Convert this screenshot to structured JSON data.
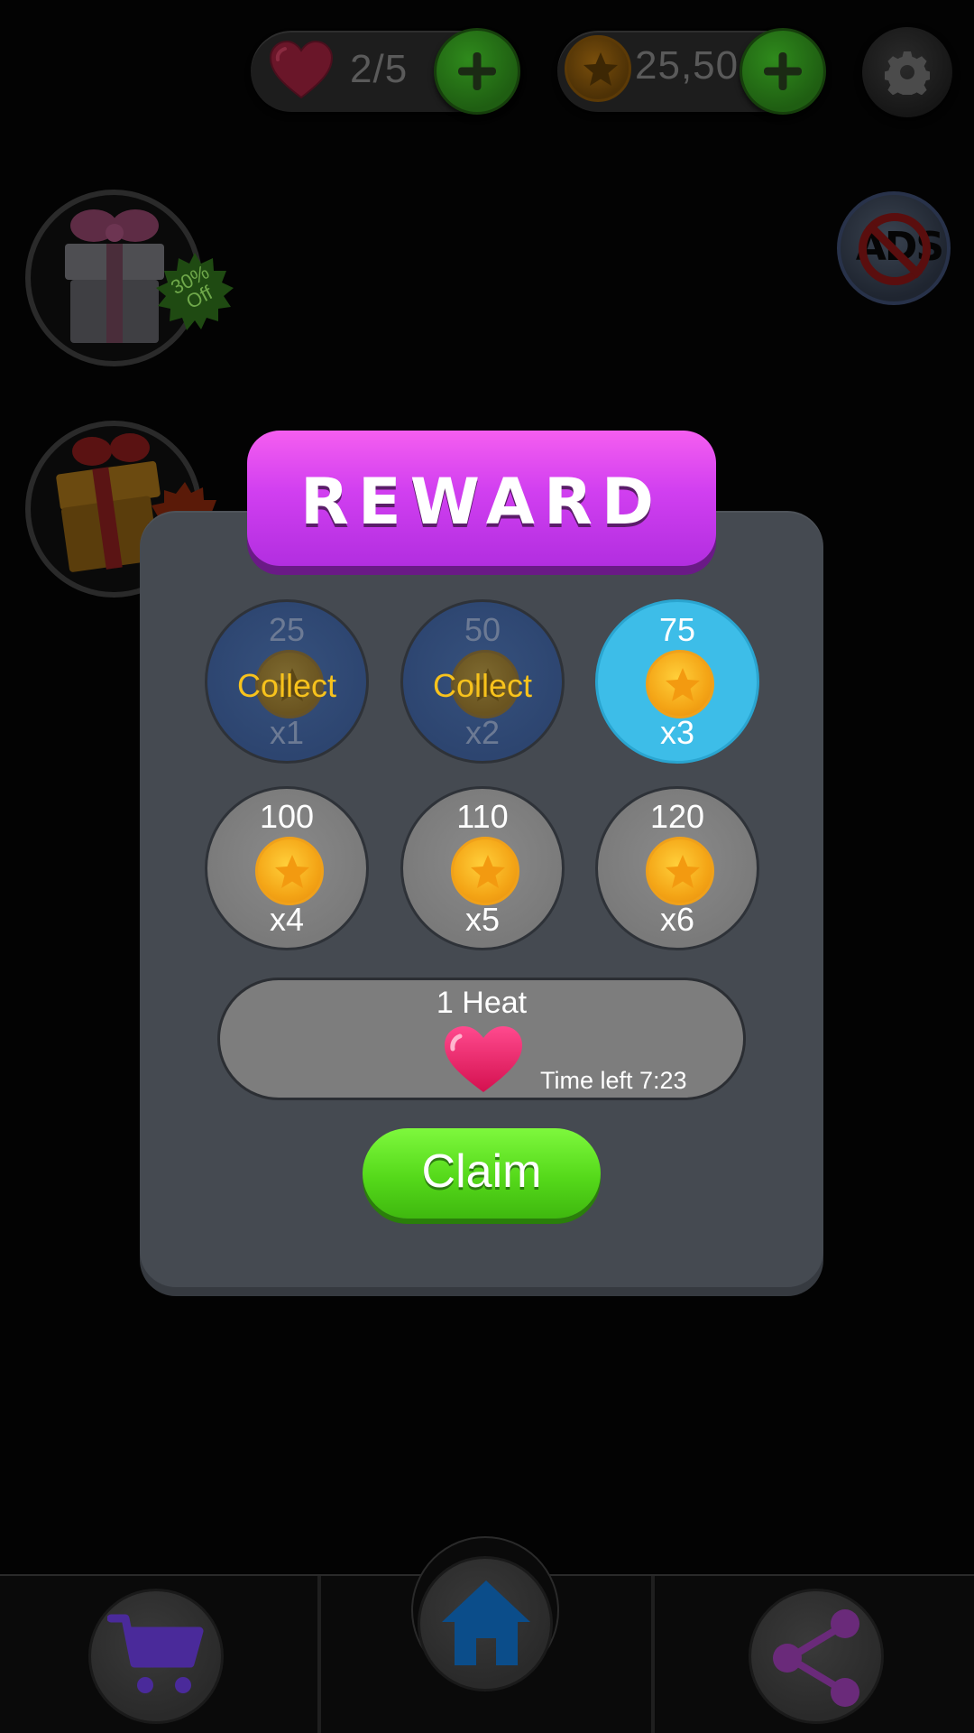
{
  "hud": {
    "lives": "2/5",
    "coins": "25,50",
    "icons": [
      "heart-icon",
      "add-lives-plus-icon",
      "coin-icon",
      "add-coins-plus-icon",
      "gear-icon"
    ]
  },
  "side": {
    "offer_badge": "30% Off",
    "ads_label": "ADS"
  },
  "dialog": {
    "title": "REWARD",
    "tiles": [
      {
        "value": "25",
        "multiplier": "x1",
        "state": "collected",
        "overlay": "Collect"
      },
      {
        "value": "50",
        "multiplier": "x2",
        "state": "collected",
        "overlay": "Collect"
      },
      {
        "value": "75",
        "multiplier": "x3",
        "state": "active"
      },
      {
        "value": "100",
        "multiplier": "x4",
        "state": "locked"
      },
      {
        "value": "110",
        "multiplier": "x5",
        "state": "locked"
      },
      {
        "value": "120",
        "multiplier": "x6",
        "state": "locked"
      }
    ],
    "heart_reward": {
      "title": "1 Heat",
      "time_left": "Time left 7:23"
    },
    "claim_label": "Claim"
  },
  "colors": {
    "banner": "#d13ff0",
    "active_tile": "#3dbde8",
    "claim": "#55d91a",
    "coin": "#f4a516",
    "collect_text": "#f7c21c"
  },
  "nav": {
    "icons": [
      "cart-icon",
      "home-icon",
      "share-icon"
    ]
  }
}
